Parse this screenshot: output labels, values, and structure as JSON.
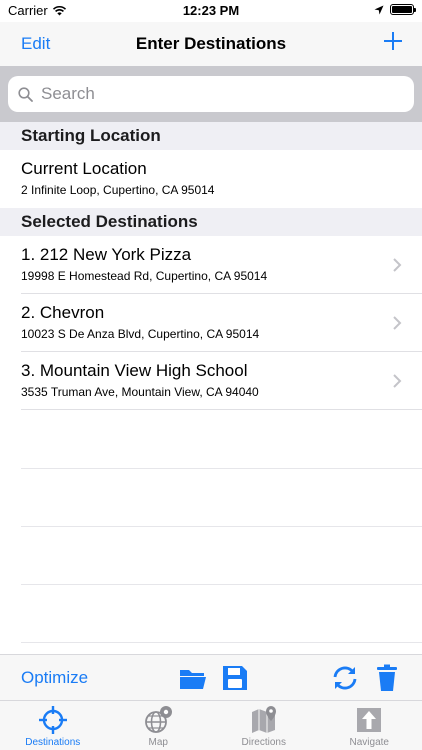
{
  "status_bar": {
    "carrier": "Carrier",
    "time": "12:23 PM"
  },
  "nav": {
    "edit_label": "Edit",
    "title": "Enter Destinations",
    "add_icon": "plus-icon"
  },
  "search": {
    "placeholder": "Search",
    "value": ""
  },
  "starting_location": {
    "header": "Starting Location",
    "title": "Current Location",
    "address": "2 Infinite Loop, Cupertino, CA 95014"
  },
  "destinations": {
    "header": "Selected Destinations",
    "items": [
      {
        "title": "1. 212 New York Pizza",
        "address": "19998 E Homestead Rd, Cupertino, CA 95014"
      },
      {
        "title": "2. Chevron",
        "address": "10023 S De Anza Blvd, Cupertino, CA 95014"
      },
      {
        "title": "3. Mountain View High School",
        "address": "3535 Truman Ave, Mountain View, CA 94040"
      }
    ]
  },
  "toolbar": {
    "optimize_label": "Optimize",
    "icons": [
      "folder-icon",
      "save-icon",
      "refresh-icon",
      "trash-icon"
    ]
  },
  "tabs": [
    {
      "label": "Destinations",
      "icon": "crosshair-icon",
      "active": true
    },
    {
      "label": "Map",
      "icon": "globe-pin-icon",
      "active": false
    },
    {
      "label": "Directions",
      "icon": "map-pin-icon",
      "active": false
    },
    {
      "label": "Navigate",
      "icon": "navigate-arrow-icon",
      "active": false
    }
  ],
  "colors": {
    "accent": "#1a7cf5",
    "inactive": "#8e8e93",
    "section_bg": "#efeff4"
  }
}
